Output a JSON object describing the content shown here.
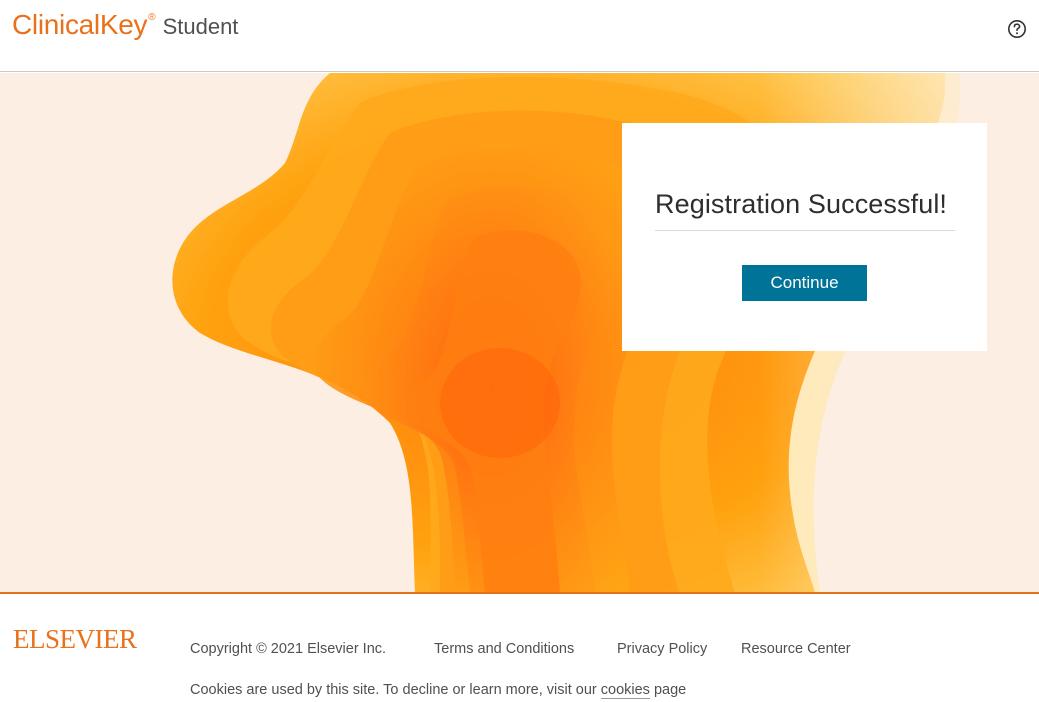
{
  "header": {
    "brand": "ClinicalKey",
    "registered_mark": "®",
    "product": "Student",
    "help_icon": "help-circle-icon"
  },
  "dialog": {
    "title": "Registration Successful!",
    "continue_label": "Continue"
  },
  "footer": {
    "logo_text": "ELSEVIER",
    "copyright": "Copyright © 2021 Elsevier Inc.",
    "links": {
      "terms": "Terms and Conditions",
      "privacy": "Privacy Policy",
      "resource_center": "Resource Center"
    },
    "cookie_notice_prefix": "Cookies are used by this site. To decline or learn more, visit our",
    "cookie_link": "cookies",
    "cookie_notice_suffix": "page"
  },
  "colors": {
    "brand_orange": "#e9711c",
    "button_blue": "#007398",
    "hero_background": "#fdeee3"
  }
}
